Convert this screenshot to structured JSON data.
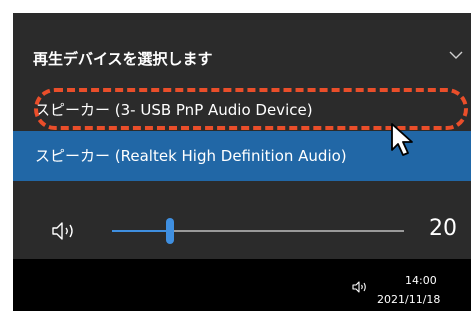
{
  "flyout": {
    "title": "再生デバイスを選択します",
    "devices": [
      {
        "label": "スピーカー (3- USB PnP Audio Device)",
        "highlighted": true
      },
      {
        "label": "スピーカー (Realtek High Definition Audio)",
        "selected": true
      }
    ],
    "volume": {
      "level": 20,
      "level_text": "20",
      "max": 100
    }
  },
  "taskbar": {
    "time": "14:00",
    "date": "2021/11/18"
  },
  "colors": {
    "flyout_bg": "#2b2b2b",
    "selected_bg": "#2167a6",
    "accent": "#3f8fe0",
    "annotation": "#ea4e2a",
    "taskbar_bg": "#000000"
  },
  "icons": [
    "chevron-down-icon",
    "speaker-icon",
    "mouse-cursor-icon",
    "tray-speaker-icon"
  ]
}
